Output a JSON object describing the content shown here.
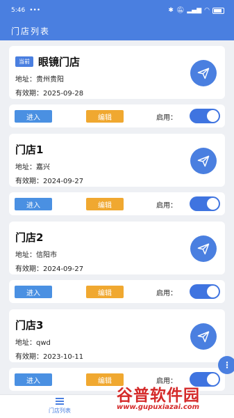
{
  "status_bar": {
    "time": "5:46",
    "dots": "•••",
    "battery_label": ""
  },
  "header": {
    "title": "门店列表"
  },
  "stores": [
    {
      "tag": "当前",
      "name": "眼镜门店",
      "address": "地址：贵州贵阳",
      "valid": "有效期：2025-09-28",
      "enter": "进入",
      "edit": "编辑",
      "enable": "启用：",
      "enabled": true
    },
    {
      "tag": "",
      "name": "门店1",
      "address": "地址：嘉兴",
      "valid": "有效期：2024-09-27",
      "enter": "进入",
      "edit": "编辑",
      "enable": "启用：",
      "enabled": true
    },
    {
      "tag": "",
      "name": "门店2",
      "address": "地址：信阳市",
      "valid": "有效期：2024-09-27",
      "enter": "进入",
      "edit": "编辑",
      "enable": "启用：",
      "enabled": true
    },
    {
      "tag": "",
      "name": "门店3",
      "address": "地址：qwd",
      "valid": "有效期：2023-10-11",
      "enter": "进入",
      "edit": "编辑",
      "enable": "启用：",
      "enabled": true
    }
  ],
  "float_button": {
    "label": "⋮"
  },
  "tabbar": {
    "tab_label": "门店列表"
  },
  "watermark": {
    "title": "谷普软件园",
    "url": "www.gupuxiazai.com"
  },
  "colors": {
    "primary": "#4a7fe0",
    "edit": "#f0a830",
    "enter": "#4a90e2",
    "toggle": "#3f74e0"
  }
}
